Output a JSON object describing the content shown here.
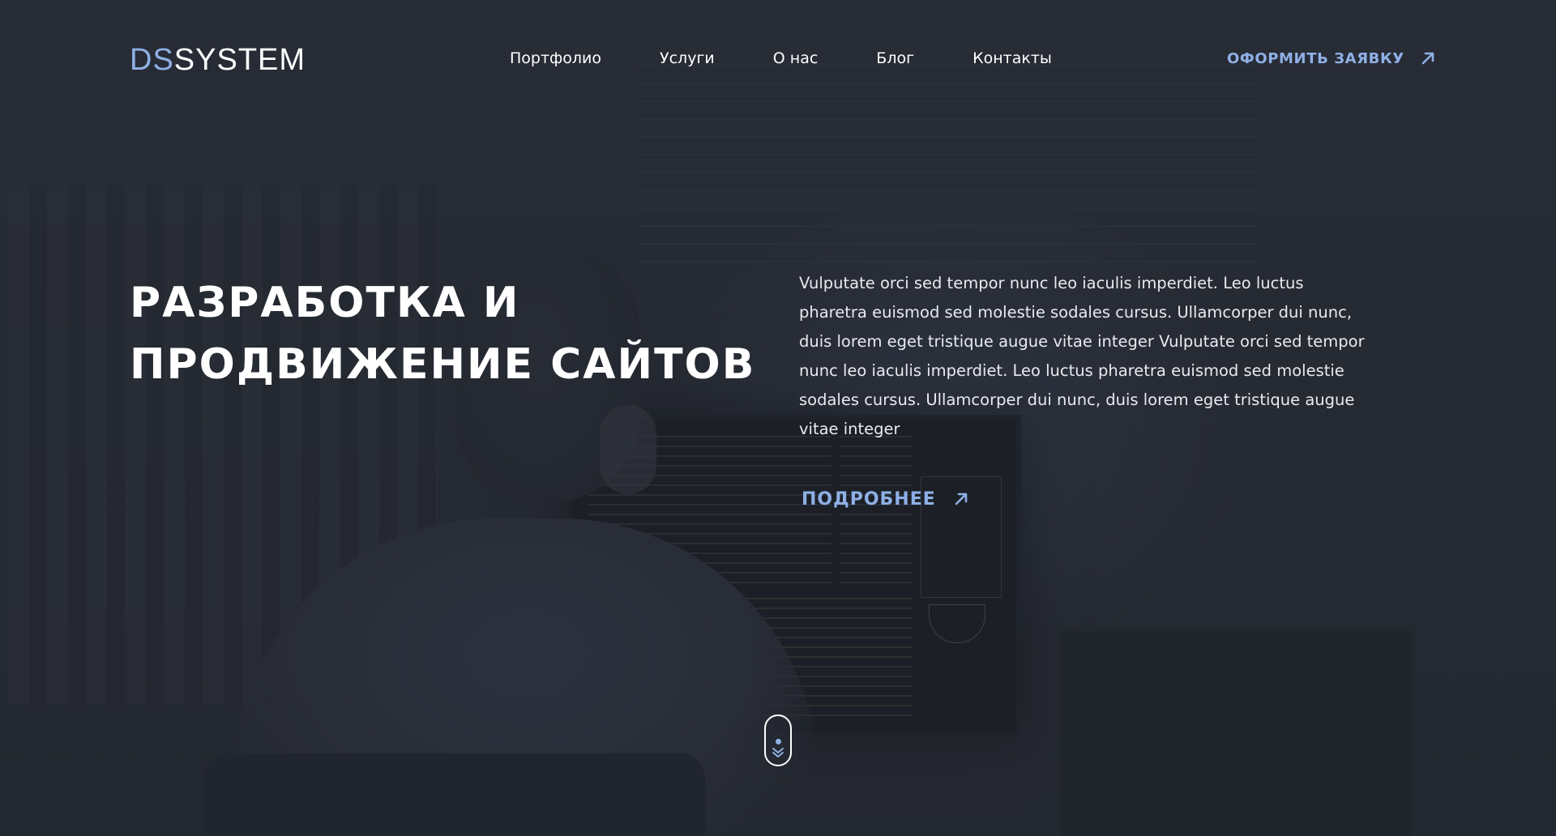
{
  "brand": {
    "logo_part1": "DS",
    "logo_part2": "SYSTEM",
    "accent_color": "#8fb0e6"
  },
  "nav": {
    "items": [
      {
        "label": "Портфолио"
      },
      {
        "label": "Услуги"
      },
      {
        "label": "О нас"
      },
      {
        "label": "Блог"
      },
      {
        "label": "Контакты"
      }
    ]
  },
  "header_cta": {
    "label": "ОФОРМИТЬ ЗАЯВКУ",
    "icon": "arrow-up-right-icon"
  },
  "hero": {
    "title_line1": "РАЗРАБОТКА И",
    "title_line2": "ПРОДВИЖЕНИЕ САЙТОВ",
    "description": "Vulputate orci sed tempor nunc leo iaculis imperdiet. Leo luctus pharetra euismod sed molestie sodales cursus. Ullamcorper dui nunc, duis lorem eget tristique augue vitae integer Vulputate orci sed tempor nunc leo iaculis imperdiet. Leo luctus pharetra euismod sed molestie sodales cursus. Ullamcorper dui nunc, duis lorem eget tristique augue vitae integer",
    "more_label": "ПОДРОБНЕЕ",
    "more_icon": "arrow-up-right-icon"
  },
  "scroll_indicator": {
    "icon": "chevron-double-down-icon"
  }
}
